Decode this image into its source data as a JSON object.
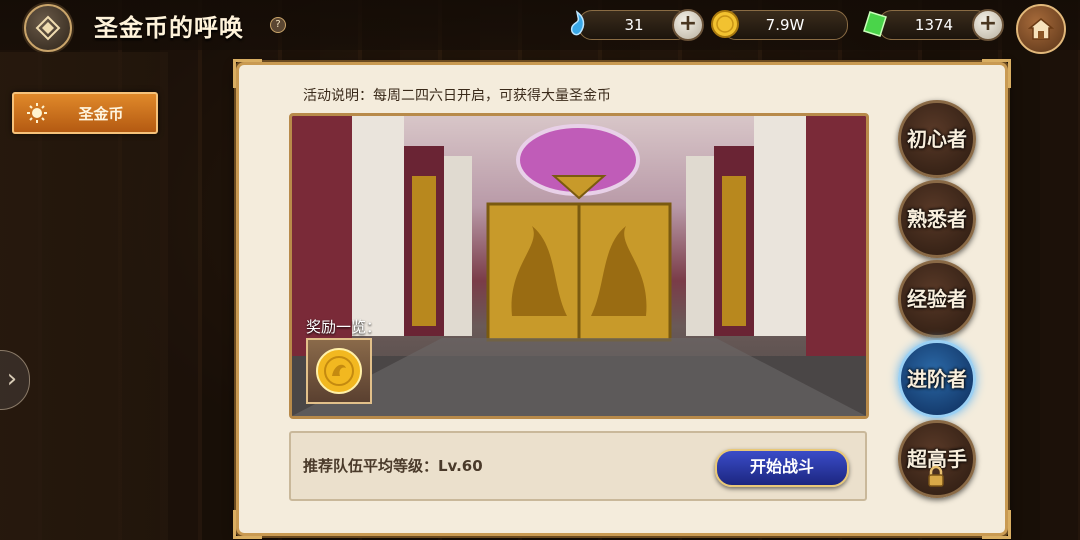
{
  "header": {
    "title": "圣金币的呼唤",
    "help_label": "?"
  },
  "resources": [
    {
      "icon": "crystal-icon",
      "value": "31"
    },
    {
      "icon": "gold-coin-icon",
      "value": "7.9W"
    },
    {
      "icon": "green-gem-icon",
      "value": "1374"
    }
  ],
  "sidebar": {
    "items": [
      {
        "label": "圣金币",
        "icon": "sun-icon",
        "selected": true
      }
    ],
    "expand_label": "›"
  },
  "panel": {
    "description": "活动说明：每周二四六日开启，可获得大量圣金币",
    "reward_label": "奖励一览：",
    "recommend": "推荐队伍平均等级：Lv.60",
    "start_button": "开始战斗"
  },
  "difficulties": [
    {
      "label": "初心者",
      "state": "normal"
    },
    {
      "label": "熟悉者",
      "state": "normal"
    },
    {
      "label": "经验者",
      "state": "normal"
    },
    {
      "label": "进阶者",
      "state": "selected"
    },
    {
      "label": "超高手",
      "state": "locked"
    }
  ],
  "colors": {
    "accent": "#c99a52",
    "sidebar_selected": "#d97a22",
    "start_button": "#2a3aa8"
  }
}
